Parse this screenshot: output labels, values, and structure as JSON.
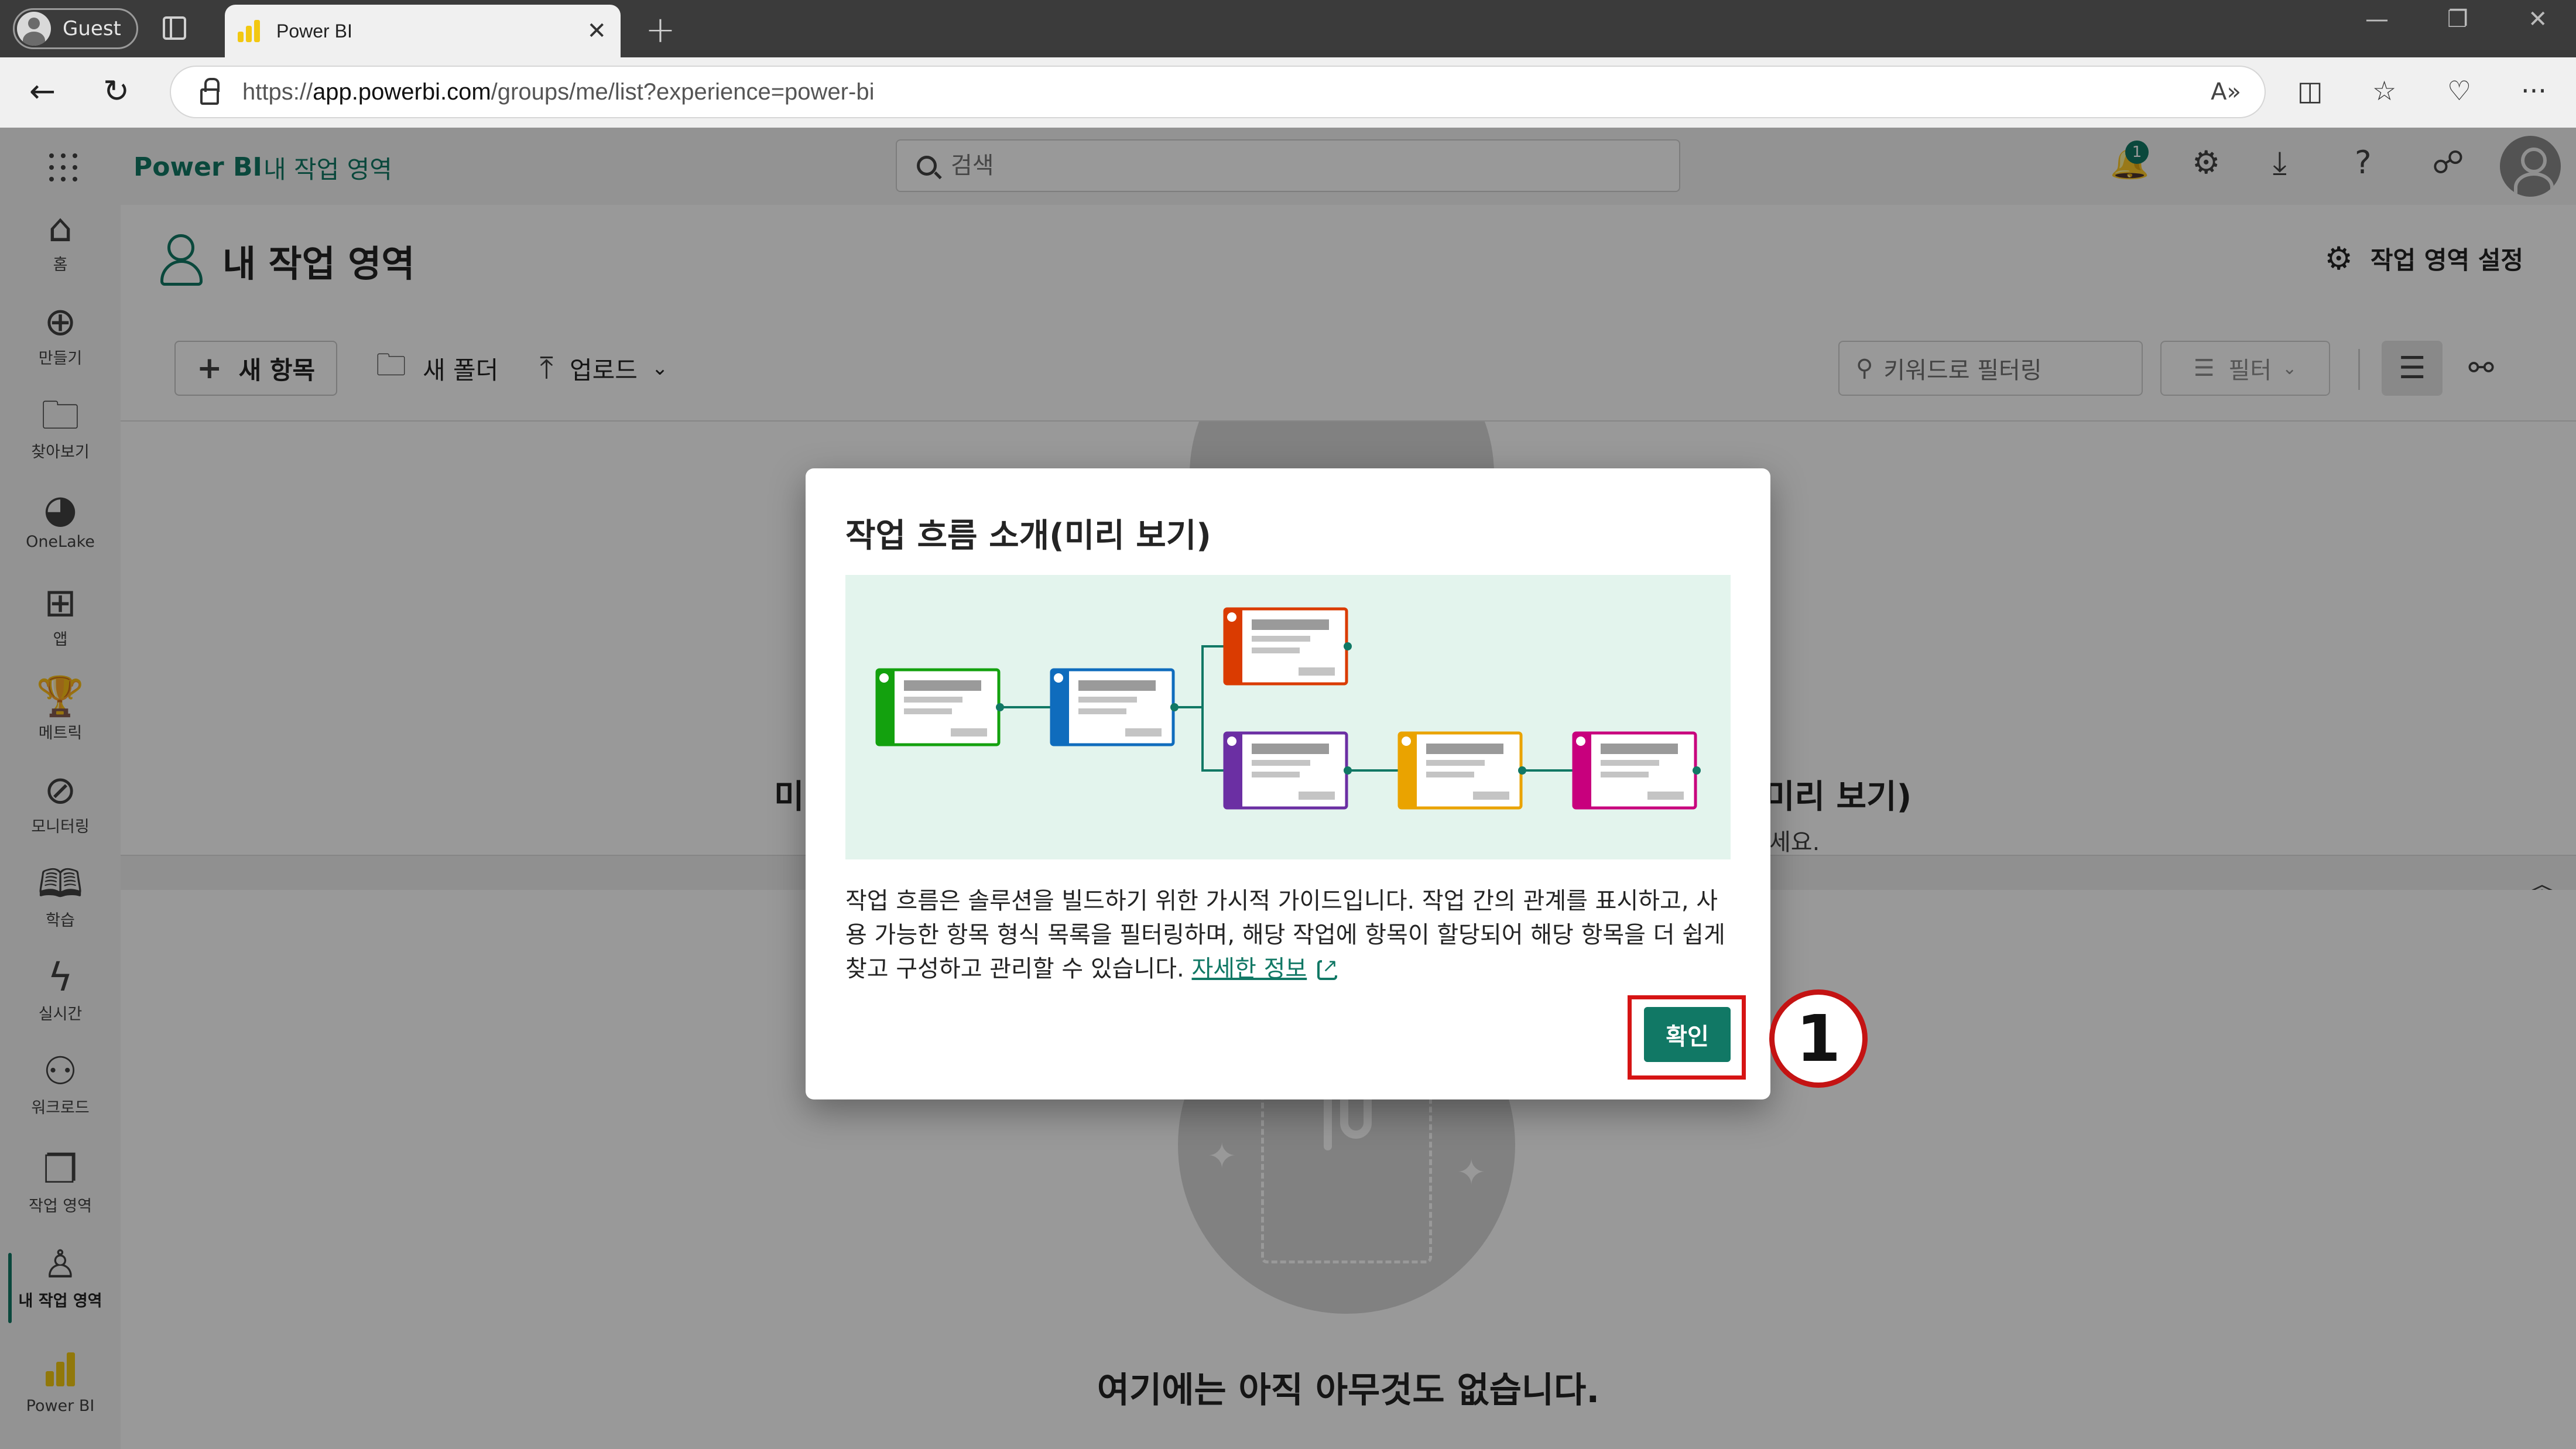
{
  "browser": {
    "profile_label": "Guest",
    "tab_title": "Power BI",
    "url_prefix": "https://",
    "url_domain": "app.powerbi.com",
    "url_path": "/groups/me/list?experience=power-bi"
  },
  "app": {
    "brand": "Power BI",
    "breadcrumb": "내 작업 영역",
    "search_placeholder": "검색",
    "notification_count": "1"
  },
  "rail": [
    {
      "label": "홈",
      "icon": "home-icon",
      "glyph": "⌂"
    },
    {
      "label": "만들기",
      "icon": "create-icon",
      "glyph": "⊕"
    },
    {
      "label": "찾아보기",
      "icon": "browse-folder-icon",
      "glyph": "🗀"
    },
    {
      "label": "OneLake",
      "icon": "onelake-icon",
      "glyph": "◕"
    },
    {
      "label": "앱",
      "icon": "apps-icon",
      "glyph": "⊞"
    },
    {
      "label": "메트릭",
      "icon": "metrics-trophy-icon",
      "glyph": "🏆"
    },
    {
      "label": "모니터링",
      "icon": "monitoring-icon",
      "glyph": "⊘"
    },
    {
      "label": "학습",
      "icon": "learn-book-icon",
      "glyph": "🕮"
    },
    {
      "label": "실시간",
      "icon": "real-time-icon",
      "glyph": "ϟ"
    },
    {
      "label": "워크로드",
      "icon": "workloads-icon",
      "glyph": "⚇"
    },
    {
      "label": "작업 영역",
      "icon": "workspaces-icon",
      "glyph": "❐"
    },
    {
      "label": "내 작업 영역",
      "icon": "my-workspace-icon",
      "glyph": "♙"
    },
    {
      "label": "Power BI",
      "icon": "power-bi-icon",
      "glyph": ""
    }
  ],
  "workspace": {
    "title": "내 작업 영역",
    "settings_label": "작업 영역 설정"
  },
  "toolbar": {
    "new_item": "새 항목",
    "new_folder": "새 폴더",
    "upload": "업로드",
    "filter_placeholder": "키워드로 필터링",
    "filter_button": "필터"
  },
  "background": {
    "left_title_fragment": "미",
    "right_title_fragment": "미리 보기)",
    "right_sub_fragment": "세요.",
    "empty_title": "여기에는 아직 아무것도 없습니다."
  },
  "dialog": {
    "title": "작업 흐름 소개(미리 보기)",
    "body": "작업 흐름은 솔루션을 빌드하기 위한 가시적 가이드입니다. 작업 간의 관계를 표시하고, 사용 가능한 항목 형식 목록을 필터링하며, 해당 작업에 항목이 할당되어 해당 항목을 더 쉽게 찾고 구성하고 관리할 수 있습니다. ",
    "link": "자세한 정보",
    "ok_button": "확인",
    "illustration_colors": [
      "#13a10e",
      "#0f6cbd",
      "#da3b01",
      "#6b2fa3",
      "#eaa300",
      "#c8007d"
    ]
  },
  "annotation": {
    "step_marker": "1"
  }
}
